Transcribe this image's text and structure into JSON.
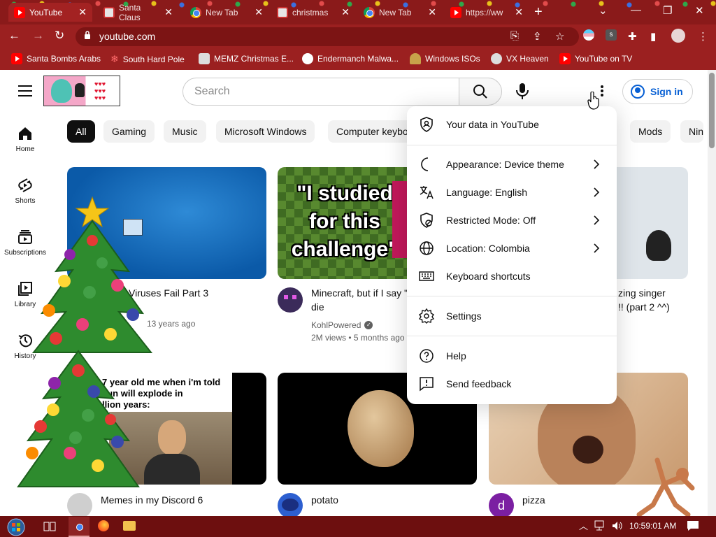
{
  "browser": {
    "tabs": [
      {
        "label": "YouTube",
        "favicon": "youtube-icon",
        "active": true
      },
      {
        "label": "Santa Claus",
        "favicon": "image-icon",
        "active": false
      },
      {
        "label": "New Tab",
        "favicon": "chrome-icon",
        "active": false
      },
      {
        "label": "christmas",
        "favicon": "image-icon",
        "active": false
      },
      {
        "label": "New Tab",
        "favicon": "chrome-icon",
        "active": false
      },
      {
        "label": "https://ww",
        "favicon": "youtube-icon",
        "active": false
      }
    ],
    "url": "youtube.com",
    "bookmarks": [
      {
        "label": "Santa Bombs Arabs",
        "icon": "youtube-icon"
      },
      {
        "label": "South Hard Pole",
        "icon": "snowflake-icon"
      },
      {
        "label": "MEMZ Christmas E...",
        "icon": "image-icon"
      },
      {
        "label": "Endermanch Malwa...",
        "icon": "panda-icon"
      },
      {
        "label": "Windows ISOs",
        "icon": "figure-icon"
      },
      {
        "label": "VX Heaven",
        "icon": "badge-icon"
      },
      {
        "label": "YouTube on TV",
        "icon": "youtube-icon"
      }
    ],
    "colors": {
      "frame": "#9b2020",
      "tabstrip": "#8a1a1a",
      "taskbar": "#6d0f0f"
    }
  },
  "youtube": {
    "search_placeholder": "Search",
    "sign_in_label": "Sign in",
    "guide": [
      {
        "label": "Home",
        "icon": "home-icon"
      },
      {
        "label": "Shorts",
        "icon": "shorts-icon"
      },
      {
        "label": "Subscriptions",
        "icon": "subscriptions-icon"
      },
      {
        "label": "Library",
        "icon": "library-icon"
      },
      {
        "label": "History",
        "icon": "history-icon"
      }
    ],
    "chips": [
      "All",
      "Gaming",
      "Music",
      "Microsoft Windows",
      "Computer keybo",
      "Mods",
      "Nin"
    ],
    "videos": [
      {
        "title": "Viruses Fail Part 3",
        "meta": "13 years ago"
      },
      {
        "title": "Minecraft, but if I say \"",
        "title2": "die",
        "channel": "KohlPowered",
        "meta": "2M views • 5 months ago",
        "thumb_text": [
          "\"I studied",
          "for this",
          "challenge\""
        ]
      },
      {
        "title": "zing singer",
        "title2": "!! (part 2 ^^)"
      },
      {
        "title": "Memes in my Discord 6",
        "thumb_text": [
          "7 year old me when i'm told",
          "sun will explode in",
          "llion years:"
        ]
      },
      {
        "title": "potato",
        "avatar_letter": ""
      },
      {
        "title": "pizza",
        "avatar_letter": "d"
      }
    ],
    "menu": [
      {
        "label": "Your data in YouTube",
        "icon": "shield-person-icon",
        "chevron": false
      },
      {
        "label": "Appearance: Device theme",
        "icon": "moon-icon",
        "chevron": true
      },
      {
        "label": "Language: English",
        "icon": "translate-icon",
        "chevron": true
      },
      {
        "label": "Restricted Mode: Off",
        "icon": "restricted-icon",
        "chevron": true
      },
      {
        "label": "Location: Colombia",
        "icon": "globe-icon",
        "chevron": true
      },
      {
        "label": "Keyboard shortcuts",
        "icon": "keyboard-icon",
        "chevron": false
      },
      {
        "label": "Settings",
        "icon": "gear-icon",
        "chevron": false
      },
      {
        "label": "Help",
        "icon": "help-icon",
        "chevron": false
      },
      {
        "label": "Send feedback",
        "icon": "feedback-icon",
        "chevron": false
      }
    ]
  },
  "taskbar": {
    "clock": "10:59:01 AM"
  }
}
